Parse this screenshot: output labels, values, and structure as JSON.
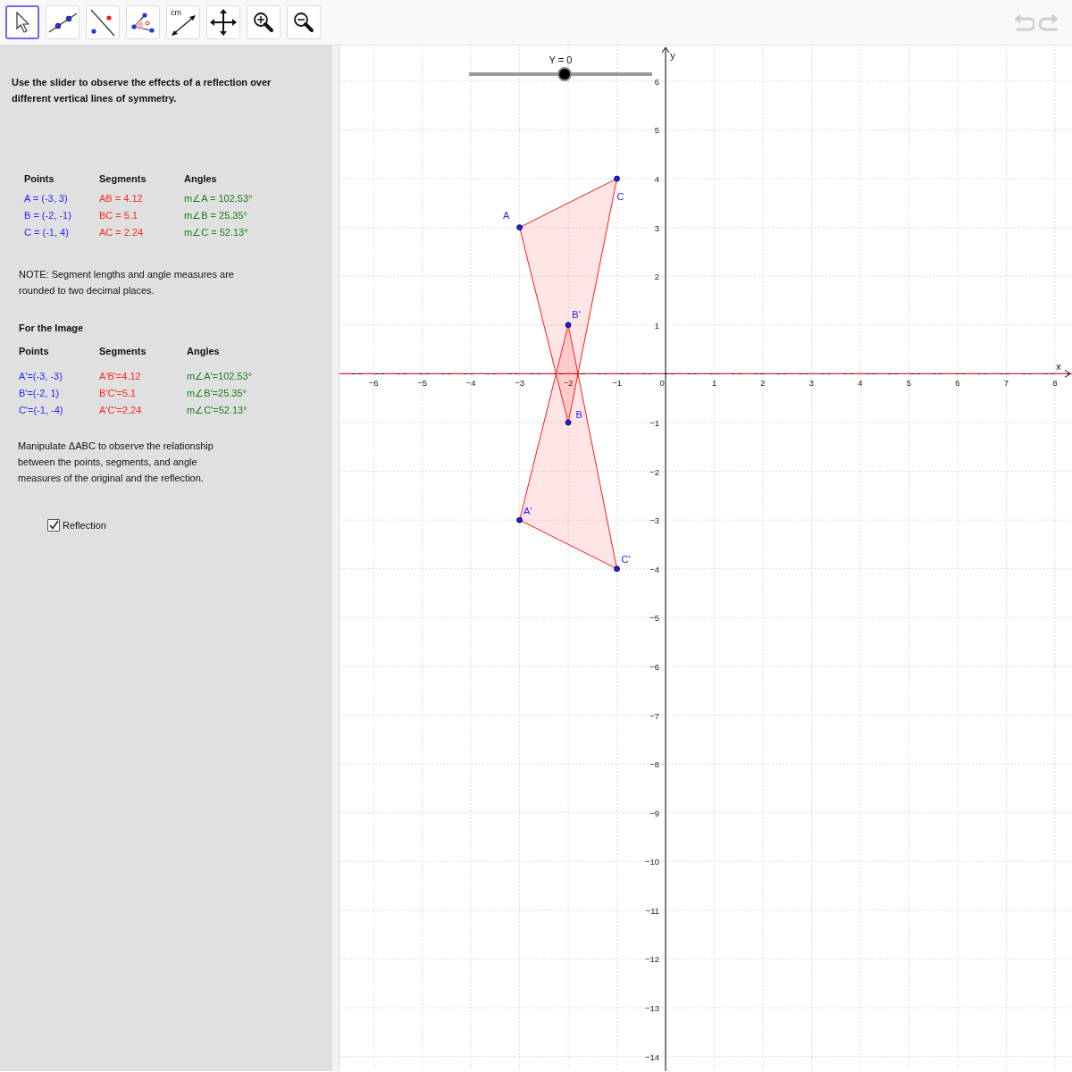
{
  "toolbar": {
    "tools": [
      {
        "kind": "move",
        "selected": true
      },
      {
        "kind": "line",
        "selected": false
      },
      {
        "kind": "reflect",
        "selected": false
      },
      {
        "kind": "angle",
        "selected": false
      },
      {
        "kind": "distance",
        "text": "cm",
        "selected": false
      },
      {
        "kind": "move-view",
        "selected": false
      },
      {
        "kind": "zoom-in",
        "selected": false
      },
      {
        "kind": "zoom-out",
        "selected": false
      }
    ],
    "history": [
      {
        "kind": "undo",
        "disabled": true
      },
      {
        "kind": "redo",
        "disabled": true
      }
    ]
  },
  "panel": {
    "intro": "Use the slider to observe the effects of a reflection over different vertical lines of symmetry.",
    "original": {
      "headers": [
        "Points",
        "Segments",
        "Angles"
      ],
      "rows": [
        [
          "A = (-3, 3)",
          "AB = 4.12",
          "m∠A = 102.53°"
        ],
        [
          "B = (-2, -1)",
          "BC = 5.1",
          "m∠B = 25.35°"
        ],
        [
          "C = (-1, 4)",
          "AC = 2.24",
          "m∠C = 52.13°"
        ]
      ]
    },
    "note": "NOTE: Segment lengths and angle measures are rounded to two decimal places.",
    "image_title": "For the Image",
    "image": {
      "headers": [
        "Points",
        "Segments",
        "Angles"
      ],
      "rows": [
        [
          "A'=(-3, -3)",
          "A'B'=4.12",
          "m∠A'=102.53°"
        ],
        [
          "B'=(-2, 1)",
          "B'C'=5.1",
          "m∠B'=25.35°"
        ],
        [
          "C'=(-1, -4)",
          "A'C'=2.24",
          "m∠C'=52.13°"
        ]
      ]
    },
    "instructions": "Manipulate ΔABC to observe the relationship between the points, segments, and angle measures of the original and the reflection.",
    "checkbox": {
      "label": "Reflection",
      "checked": true
    }
  },
  "graph": {
    "slider": {
      "label": "Y = 0",
      "level": 0.5
    },
    "chart_data": {
      "type": "scatter",
      "xlabel": "x",
      "ylabel": "y",
      "xlim": [
        -6.7,
        8.35
      ],
      "ylim": [
        -14.3,
        6.73
      ],
      "xticks": [
        {
          "value": -6,
          "label": "−6"
        },
        {
          "value": -5,
          "label": "−5"
        },
        {
          "value": -4,
          "label": "−4"
        },
        {
          "value": -3,
          "label": "−3"
        },
        {
          "value": -2,
          "label": "−2"
        },
        {
          "value": -1,
          "label": "−1"
        },
        {
          "value": 0,
          "label": "0"
        },
        {
          "value": 1,
          "label": "1"
        },
        {
          "value": 2,
          "label": "2"
        },
        {
          "value": 3,
          "label": "3"
        },
        {
          "value": 4,
          "label": "4"
        },
        {
          "value": 5,
          "label": "5"
        },
        {
          "value": 6,
          "label": "6"
        },
        {
          "value": 7,
          "label": "7"
        },
        {
          "value": 8,
          "label": "8"
        }
      ],
      "yticks": [
        {
          "value": 6,
          "label": "6"
        },
        {
          "value": 5,
          "label": "5"
        },
        {
          "value": 4,
          "label": "4"
        },
        {
          "value": 3,
          "label": "3"
        },
        {
          "value": 2,
          "label": "2"
        },
        {
          "value": 1,
          "label": "1"
        },
        {
          "value": -1,
          "label": "−1"
        },
        {
          "value": -2,
          "label": "−2"
        },
        {
          "value": -3,
          "label": "−3"
        },
        {
          "value": -4,
          "label": "−4"
        },
        {
          "value": -5,
          "label": "−5"
        },
        {
          "value": -6,
          "label": "−6"
        },
        {
          "value": -7,
          "label": "−7"
        },
        {
          "value": -8,
          "label": "−8"
        },
        {
          "value": -9,
          "label": "−9"
        },
        {
          "value": -10,
          "label": "−10"
        },
        {
          "value": -11,
          "label": "−11"
        },
        {
          "value": -12,
          "label": "−12"
        },
        {
          "value": -13,
          "label": "−13"
        },
        {
          "value": -14,
          "label": "−14"
        }
      ],
      "x": [
        -3,
        -2,
        -1
      ],
      "grid": true,
      "series": [
        {
          "color": "#1a1aff",
          "values": [
            3,
            -1,
            4
          ]
        },
        {
          "color": "#1a1aff",
          "values": [
            -3,
            1,
            -4
          ]
        }
      ],
      "ref_lines": [
        {
          "axis": "y",
          "value": 0
        }
      ],
      "annotations": [
        "A",
        "B",
        "C",
        "A'",
        "B'",
        "C'"
      ]
    }
  }
}
